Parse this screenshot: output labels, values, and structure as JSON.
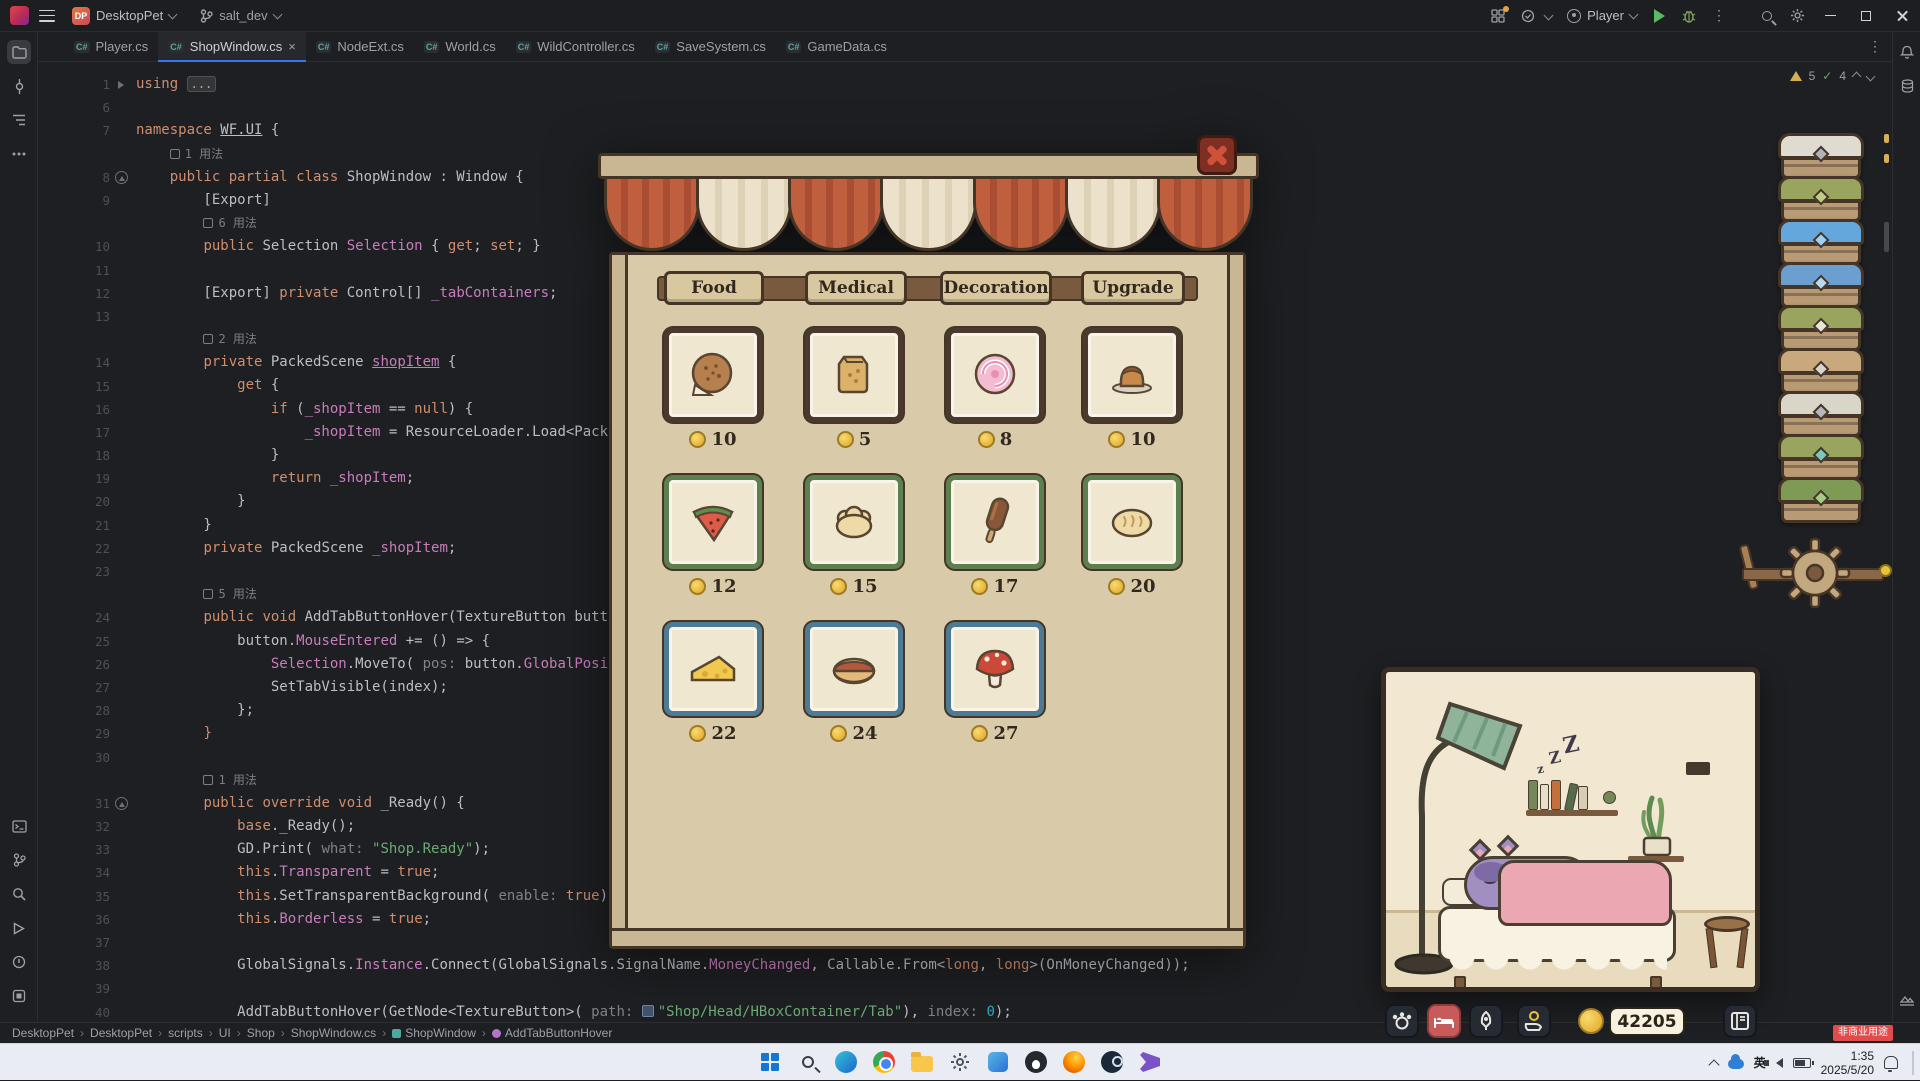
{
  "ide": {
    "titlebar": {
      "project": "DesktopPet",
      "project_badge": "DP",
      "branch": "salt_dev",
      "run_config": "Player"
    },
    "tabbar": {
      "cs_icon": "C#",
      "tabs": [
        {
          "label": "Player.cs"
        },
        {
          "label": "ShopWindow.cs"
        },
        {
          "label": "NodeExt.cs"
        },
        {
          "label": "World.cs"
        },
        {
          "label": "WildController.cs"
        },
        {
          "label": "SaveSystem.cs"
        },
        {
          "label": "GameData.cs"
        }
      ]
    },
    "inspect": {
      "warn": "5",
      "pass": "4"
    },
    "code_lines": [
      {
        "n": "1",
        "gi": "fold",
        "seg": [
          [
            "using",
            "k"
          ],
          [
            " ",
            "p"
          ],
          [
            "...",
            "d"
          ]
        ]
      },
      {
        "n": "6",
        "seg": []
      },
      {
        "n": "7",
        "seg": [
          [
            "namespace ",
            "k"
          ],
          [
            "WF.UI",
            "nu"
          ],
          [
            " {",
            "p"
          ]
        ]
      },
      {
        "n": "",
        "seg": [
          [
            "    ",
            "p"
          ],
          [
            "",
            "cv"
          ],
          [
            "1 用法",
            "a"
          ]
        ]
      },
      {
        "n": "8",
        "gi": "ovr",
        "seg": [
          [
            "    ",
            "p"
          ],
          [
            "public partial class ",
            "k"
          ],
          [
            "ShopWindow : Window {",
            "p"
          ]
        ]
      },
      {
        "n": "9",
        "seg": [
          [
            "        [Export]",
            "p"
          ]
        ]
      },
      {
        "n": "",
        "seg": [
          [
            "        ",
            "p"
          ],
          [
            "",
            "cv"
          ],
          [
            "6 用法",
            "a"
          ]
        ]
      },
      {
        "n": "10",
        "seg": [
          [
            "        ",
            "p"
          ],
          [
            "public ",
            "k"
          ],
          [
            "Selection ",
            "p"
          ],
          [
            "Selection",
            "f"
          ],
          [
            " { ",
            "p"
          ],
          [
            "get",
            "k"
          ],
          [
            "; ",
            "p"
          ],
          [
            "set",
            "k"
          ],
          [
            "; }",
            "p"
          ]
        ]
      },
      {
        "n": "11",
        "seg": []
      },
      {
        "n": "12",
        "seg": [
          [
            "        [Export] ",
            "p"
          ],
          [
            "private ",
            "k"
          ],
          [
            "Control[] ",
            "p"
          ],
          [
            "_tabContainers",
            "f"
          ],
          [
            ";",
            "p"
          ]
        ]
      },
      {
        "n": "13",
        "seg": []
      },
      {
        "n": "",
        "seg": [
          [
            "        ",
            "p"
          ],
          [
            "",
            "cv"
          ],
          [
            "2 用法",
            "a"
          ]
        ]
      },
      {
        "n": "14",
        "seg": [
          [
            "        ",
            "p"
          ],
          [
            "private ",
            "k"
          ],
          [
            "PackedScene ",
            "p"
          ],
          [
            "shopItem",
            "fu"
          ],
          [
            " {",
            "p"
          ]
        ]
      },
      {
        "n": "15",
        "seg": [
          [
            "            ",
            "p"
          ],
          [
            "get",
            "k"
          ],
          [
            " {",
            "p"
          ]
        ]
      },
      {
        "n": "16",
        "seg": [
          [
            "                ",
            "p"
          ],
          [
            "if",
            "k"
          ],
          [
            " (",
            "p"
          ],
          [
            "_shopItem",
            "f"
          ],
          [
            " == ",
            "p"
          ],
          [
            "null",
            "k"
          ],
          [
            ") {",
            "p"
          ]
        ]
      },
      {
        "n": "17",
        "seg": [
          [
            "                    ",
            "p"
          ],
          [
            "_shopItem",
            "f"
          ],
          [
            " = ResourceLoader.Load<Packe",
            "p"
          ]
        ]
      },
      {
        "n": "18",
        "seg": [
          [
            "                }",
            "p"
          ]
        ]
      },
      {
        "n": "19",
        "seg": [
          [
            "                ",
            "p"
          ],
          [
            "return ",
            "k"
          ],
          [
            "_shopItem",
            "f"
          ],
          [
            ";",
            "p"
          ]
        ]
      },
      {
        "n": "20",
        "seg": [
          [
            "            }",
            "p"
          ]
        ]
      },
      {
        "n": "21",
        "seg": [
          [
            "        }",
            "p"
          ]
        ]
      },
      {
        "n": "22",
        "seg": [
          [
            "        ",
            "p"
          ],
          [
            "private ",
            "k"
          ],
          [
            "PackedScene ",
            "p"
          ],
          [
            "_shopItem",
            "f"
          ],
          [
            ";",
            "p"
          ]
        ]
      },
      {
        "n": "23",
        "seg": []
      },
      {
        "n": "",
        "seg": [
          [
            "        ",
            "p"
          ],
          [
            "",
            "cv"
          ],
          [
            "5 用法",
            "a"
          ]
        ]
      },
      {
        "n": "24",
        "seg": [
          [
            "        ",
            "p"
          ],
          [
            "public void ",
            "k"
          ],
          [
            "AddTabButtonHover(TextureButton butto",
            "p"
          ]
        ]
      },
      {
        "n": "25",
        "seg": [
          [
            "            button.",
            "p"
          ],
          [
            "MouseEntered",
            "f"
          ],
          [
            " += () => {",
            "p"
          ]
        ]
      },
      {
        "n": "26",
        "seg": [
          [
            "                ",
            "p"
          ],
          [
            "Selection",
            "f"
          ],
          [
            ".MoveTo( ",
            "p"
          ],
          [
            "pos: ",
            "h"
          ],
          [
            "button.",
            "p"
          ],
          [
            "GlobalPositio",
            "f"
          ]
        ]
      },
      {
        "n": "27",
        "seg": [
          [
            "                SetTabVisible(index);",
            "p"
          ]
        ]
      },
      {
        "n": "28",
        "seg": [
          [
            "            };",
            "p"
          ]
        ]
      },
      {
        "n": "29",
        "seg": [
          [
            "        ",
            "p"
          ],
          [
            "}",
            "r"
          ]
        ]
      },
      {
        "n": "30",
        "seg": []
      },
      {
        "n": "",
        "seg": [
          [
            "        ",
            "p"
          ],
          [
            "",
            "cv"
          ],
          [
            "1 用法",
            "a"
          ]
        ]
      },
      {
        "n": "31",
        "gi": "ovr",
        "seg": [
          [
            "        ",
            "p"
          ],
          [
            "public override void ",
            "k"
          ],
          [
            "_Ready() {",
            "p"
          ]
        ]
      },
      {
        "n": "32",
        "seg": [
          [
            "            ",
            "p"
          ],
          [
            "base",
            "k"
          ],
          [
            "._Ready();",
            "p"
          ]
        ]
      },
      {
        "n": "33",
        "seg": [
          [
            "            GD.Print( ",
            "p"
          ],
          [
            "what: ",
            "h"
          ],
          [
            "\"Shop.Ready\"",
            "s"
          ],
          [
            ");",
            "p"
          ]
        ]
      },
      {
        "n": "34",
        "seg": [
          [
            "            ",
            "p"
          ],
          [
            "this",
            "k"
          ],
          [
            ".",
            "p"
          ],
          [
            "Transparent",
            "f"
          ],
          [
            " = ",
            "p"
          ],
          [
            "true",
            "k"
          ],
          [
            ";",
            "p"
          ]
        ]
      },
      {
        "n": "35",
        "seg": [
          [
            "            ",
            "p"
          ],
          [
            "this",
            "k"
          ],
          [
            ".SetTransparentBackground( ",
            "p"
          ],
          [
            "enable: ",
            "h"
          ],
          [
            "true",
            "k"
          ],
          [
            ");",
            "p"
          ]
        ]
      },
      {
        "n": "36",
        "seg": [
          [
            "            ",
            "p"
          ],
          [
            "this",
            "k"
          ],
          [
            ".",
            "p"
          ],
          [
            "Borderless",
            "f"
          ],
          [
            " = ",
            "p"
          ],
          [
            "true",
            "k"
          ],
          [
            ";",
            "p"
          ]
        ]
      },
      {
        "n": "37",
        "seg": []
      },
      {
        "n": "38",
        "seg": [
          [
            "            GlobalSignals.",
            "p"
          ],
          [
            "Instance",
            "f"
          ],
          [
            ".Connect(GlobalSignals.SignalName.",
            "p"
          ],
          [
            "MoneyChanged",
            "f"
          ],
          [
            ", Callable.From<",
            "p"
          ],
          [
            "long",
            "k"
          ],
          [
            ", ",
            "p"
          ],
          [
            "long",
            "k"
          ],
          [
            ">(OnMoneyChanged));",
            "p"
          ]
        ]
      },
      {
        "n": "39",
        "seg": []
      },
      {
        "n": "40",
        "seg": [
          [
            "            AddTabButtonHover(GetNode<TextureButton>( ",
            "p"
          ],
          [
            "path: ",
            "h"
          ],
          [
            "",
            "ic"
          ],
          [
            "\"Shop/Head/HBoxContainer/Tab\"",
            "s"
          ],
          [
            "), ",
            "p"
          ],
          [
            "index: ",
            "h"
          ],
          [
            "0",
            "n"
          ],
          [
            ");",
            "p"
          ]
        ]
      }
    ],
    "statusbar": {
      "crumbs": [
        "DesktopPet",
        "DesktopPet",
        "scripts",
        "UI",
        "Shop",
        "ShopWindow.cs",
        "ShopWindow",
        "AddTabButtonHover"
      ],
      "watermark": "非商业用途"
    }
  },
  "shop": {
    "tabs": [
      "Food",
      "Medical",
      "Decoration",
      "Upgrade"
    ],
    "items": [
      {
        "name": "cookie",
        "price": "10",
        "tier": "brown"
      },
      {
        "name": "snack-bag",
        "price": "5",
        "tier": "brown"
      },
      {
        "name": "candy",
        "price": "8",
        "tier": "brown"
      },
      {
        "name": "pudding",
        "price": "10",
        "tier": "brown"
      },
      {
        "name": "watermelon",
        "price": "12",
        "tier": "green"
      },
      {
        "name": "dumpling",
        "price": "15",
        "tier": "green"
      },
      {
        "name": "popsicle",
        "price": "17",
        "tier": "green"
      },
      {
        "name": "bread",
        "price": "20",
        "tier": "green"
      },
      {
        "name": "cheese",
        "price": "22",
        "tier": "blue"
      },
      {
        "name": "hotdog",
        "price": "24",
        "tier": "blue"
      },
      {
        "name": "mushroom",
        "price": "27",
        "tier": "blue"
      }
    ]
  },
  "pet": {
    "money": "42205",
    "zzz": [
      "Z",
      "Z",
      "z"
    ],
    "chests": [
      {
        "lid": "#dfdbd0",
        "gem": "#aeb4ba"
      },
      {
        "lid": "#99a45e",
        "gem": "#c2cc86"
      },
      {
        "lid": "#63a7dd",
        "gem": "#9ed1f2"
      },
      {
        "lid": "#6b9fd0",
        "gem": "#b7d9f2"
      },
      {
        "lid": "#99a45e",
        "gem": "#e8e4d6"
      },
      {
        "lid": "#c8a87c",
        "gem": "#d7d4cb"
      },
      {
        "lid": "#d9d5c9",
        "gem": "#b3b9bf"
      },
      {
        "lid": "#99a45e",
        "gem": "#79c8bb"
      },
      {
        "lid": "#7e9a55",
        "gem": "#a5cc86"
      }
    ]
  },
  "taskbar": {
    "time": "1:35",
    "date": "2025/5/20",
    "ime": "英"
  }
}
